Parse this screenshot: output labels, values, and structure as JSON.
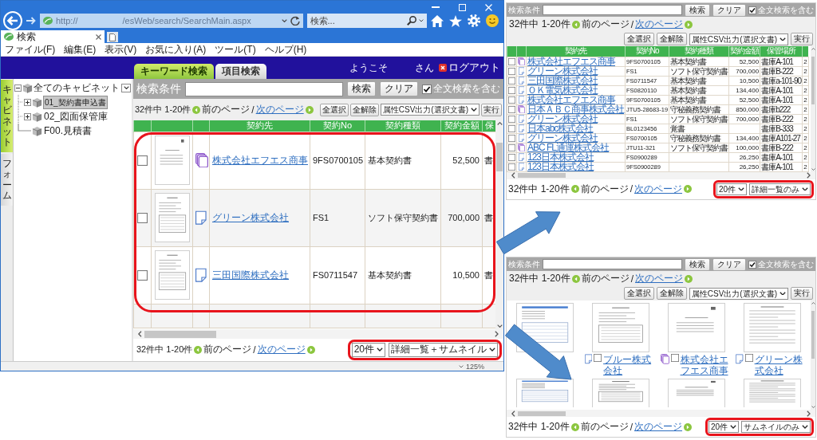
{
  "browser": {
    "address_scheme": "http://",
    "address_path": "/esWeb/search/SearchMain.aspx",
    "search_placeholder": "検索...",
    "tab_title": "検索",
    "menu": [
      "ファイル(F)",
      "編集(E)",
      "表示(V)",
      "お気に入り(A)",
      "ツール(T)",
      "ヘルプ(H)"
    ],
    "zoom": "125%"
  },
  "app": {
    "tabs": [
      {
        "label": "キーワード検索",
        "selected": true
      },
      {
        "label": "項目検索",
        "selected": false
      }
    ],
    "welcome": "ようこそ",
    "honorific": "さん",
    "logout": "ログアウト",
    "side_tabs": [
      {
        "label": "キャビネット",
        "selected": true
      },
      {
        "label": "フォーム",
        "selected": false
      }
    ],
    "tree": {
      "label": "全てのキャビネット",
      "expanded": true,
      "selected": false,
      "children": [
        {
          "label": "01_契約書申込書",
          "kind": "group",
          "expanded": false,
          "selected": true
        },
        {
          "label": "02_図面保管庫",
          "kind": "group",
          "expanded": false,
          "selected": false
        },
        {
          "label": "F00.見積書",
          "kind": "item",
          "selected": false
        }
      ]
    },
    "search": {
      "label": "検索条件",
      "search_button": "検索",
      "clear_button": "クリア",
      "fulltext": {
        "label": "全文検索を含む",
        "checked": true
      }
    },
    "pager": {
      "count": "32件中 1-20件",
      "links": [
        {
          "label": "前のページ",
          "disabled": true
        },
        {
          "label": "次のページ",
          "disabled": false
        }
      ],
      "separator": "/"
    },
    "actions": {
      "select_all": "全選択",
      "clear_all": "全解除",
      "export": "属性CSV出力(選択文書)",
      "run": "実行"
    },
    "table": {
      "columns": [
        "契約先",
        "契約No",
        "契約種類",
        "契約金額",
        "保"
      ],
      "rows": [
        {
          "checked": false,
          "kind": "multi",
          "company": "株式会社エフエス商事",
          "number": "9FS0700105",
          "type": "基本契約書",
          "amount": "52,500",
          "location": "書"
        },
        {
          "checked": false,
          "kind": "single",
          "company": "グリーン株式会社",
          "number": "FS1",
          "type": "ソフト保守契約書",
          "amount": "700,000",
          "location": "書"
        },
        {
          "checked": false,
          "kind": "single",
          "company": "三田国際株式会社",
          "number": "FS0711547",
          "type": "基本契約書",
          "amount": "10,500",
          "location": "書"
        }
      ]
    },
    "footer": {
      "pager": {
        "count": "32件中 1-20件",
        "links": [
          {
            "label": "前のページ",
            "disabled": true
          },
          {
            "label": "次のページ",
            "disabled": false
          }
        ],
        "separator": "/"
      },
      "page_size": "20件",
      "view": "詳細一覧＋サムネイル"
    }
  },
  "insets": [
    {
      "kind": "table",
      "search": {
        "label": "検索条件",
        "search_button": "検索",
        "clear_button": "クリア",
        "fulltext": {
          "label": "全文検索を含む",
          "checked": true
        }
      },
      "pager": {
        "count": "32件中 1-20件",
        "links": [
          {
            "label": "前のページ",
            "disabled": true
          },
          {
            "label": "次のページ",
            "disabled": false
          }
        ],
        "separator": "/"
      },
      "actions": {
        "select_all": "全選択",
        "clear_all": "全解除",
        "export": "属性CSV出力(選択文書)",
        "run": "実行"
      },
      "table": {
        "columns": [
          "契約先",
          "契約No",
          "契約種類",
          "契約金額",
          "保管場所"
        ],
        "rows": [
          {
            "checked": false,
            "kind": "multi",
            "company": "株式会社エフエス商事",
            "number": "9FS0700105",
            "type": "基本契約書",
            "amount": "52,500",
            "location": "書庫A-101",
            "column_8": "2"
          },
          {
            "checked": false,
            "kind": "single",
            "company": "グリーン株式会社",
            "number": "FS1",
            "type": "ソフト保守契約書",
            "amount": "700,000",
            "location": "書庫B-222",
            "column_8": "2"
          },
          {
            "checked": false,
            "kind": "single",
            "company": "三田国際株式会社",
            "number": "FS0711547",
            "type": "基本契約書",
            "amount": "10,500",
            "location": "書庫a-101-90",
            "column_8": "2"
          },
          {
            "checked": false,
            "kind": "single",
            "company": "ＯＫ電気株式会社",
            "number": "FS0820110",
            "type": "基本契約書",
            "amount": "134,400",
            "location": "書庫A-101",
            "column_8": "2"
          },
          {
            "checked": false,
            "kind": "single",
            "company": "株式会社エフエス商事",
            "number": "9FS0700105",
            "type": "基本契約書",
            "amount": "52,500",
            "location": "書庫A-101",
            "column_8": "2"
          },
          {
            "checked": false,
            "kind": "multi",
            "company": "日本ＡＢＣ商事株式会社",
            "number": "JTU5-28683-19",
            "type": "守秘義務契約書",
            "amount": "850,000",
            "location": "書庫b222",
            "column_8": "2"
          },
          {
            "checked": false,
            "kind": "single",
            "company": "グリーン株式会社",
            "number": "FS1",
            "type": "ソフト保守契約書",
            "amount": "700,000",
            "location": "書庫B-222",
            "column_8": "2"
          },
          {
            "checked": false,
            "kind": "single",
            "company": "日本abc株式会社",
            "number": "BL0123456",
            "type": "覚書",
            "location": "書庫B-333",
            "column_8": "2"
          },
          {
            "checked": false,
            "kind": "single",
            "company": "グリーン株式会社",
            "number": "FS0700105",
            "type": "守秘義務契約書",
            "amount": "134,400",
            "location": "書庫A101-27",
            "column_8": "2"
          },
          {
            "checked": false,
            "kind": "multi",
            "company": "ABC FL通運株式会社",
            "number": "JTU11-321",
            "type": "ソフト保守契約書",
            "amount": "100,000",
            "location": "書庫B-222",
            "column_8": "2"
          },
          {
            "checked": false,
            "kind": "single",
            "company": "123日本株式会社",
            "number": "FS0900289",
            "amount": "26,250",
            "location": "書庫A-101",
            "column_8": "2"
          },
          {
            "checked": false,
            "kind": "single",
            "company": "123日本株式会社",
            "number": "9FS0900289",
            "amount": "26,250",
            "location": "書庫A-101",
            "column_8": "2"
          }
        ]
      },
      "footer": {
        "pager": {
          "count": "32件中 1-20件",
          "links": [
            {
              "label": "前のページ",
              "disabled": true
            },
            {
              "label": "次のページ",
              "disabled": false
            }
          ],
          "separator": "/"
        },
        "page_size": "20件",
        "view": "詳細一覧のみ"
      }
    },
    {
      "kind": "thumbnails",
      "search": {
        "label": "検索条件",
        "search_button": "検索",
        "clear_button": "クリア",
        "fulltext": {
          "label": "全文検索を含む",
          "checked": true
        }
      },
      "pager": {
        "count": "32件中 1-20件",
        "links": [
          {
            "label": "前のページ",
            "disabled": true
          },
          {
            "label": "次のページ",
            "disabled": false
          }
        ],
        "separator": "/"
      },
      "actions": {
        "select_all": "全選択",
        "clear_all": "全解除",
        "export": "属性CSV出力(選択文書)",
        "run": "実行"
      },
      "items": [
        {
          "kind": "plain"
        },
        {
          "kind": "single",
          "checked": false,
          "company": "ブルー株式会社"
        },
        {
          "kind": "multi",
          "checked": false,
          "company": "株式会社エフエス商事"
        },
        {
          "kind": "single",
          "checked": false,
          "company": "グリーン株式会社"
        },
        {
          "kind": "plain"
        },
        {
          "kind": "plain"
        },
        {
          "kind": "plain"
        },
        {
          "kind": "plain"
        }
      ],
      "footer": {
        "pager": {
          "count": "32件中 1-20件",
          "links": [
            {
              "label": "前のページ",
              "disabled": true
            },
            {
              "label": "次のページ",
              "disabled": false
            }
          ],
          "separator": "/"
        },
        "page_size": "20件",
        "view": "サムネイルのみ"
      }
    }
  ]
}
